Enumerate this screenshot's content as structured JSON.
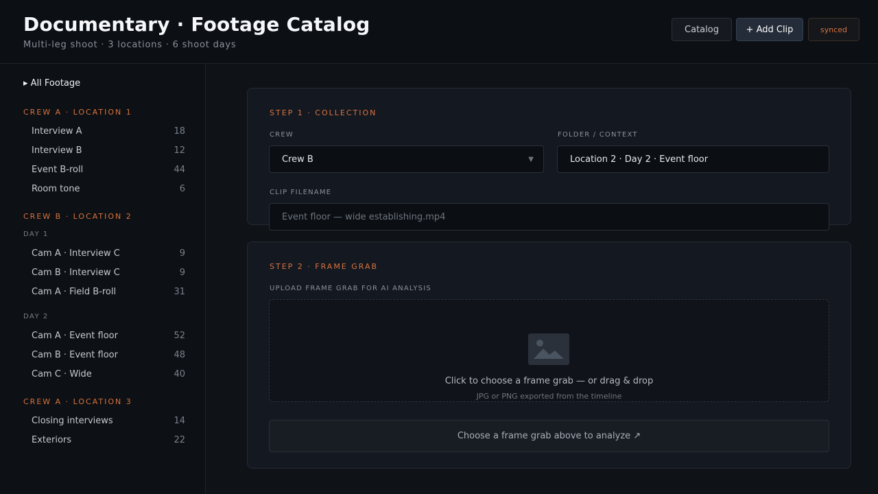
{
  "header": {
    "title": "Documentary · Footage Catalog",
    "subtitle": "Multi-leg shoot · 3 locations · 6 shoot days",
    "buttons": {
      "catalog": "Catalog",
      "add_clip": "+ Add Clip",
      "synced": "synced"
    }
  },
  "sidebar": {
    "all_label": "▸ All Footage",
    "groups": [
      {
        "title": "CREW A · LOCATION 1",
        "items": [
          {
            "label": "Interview A",
            "count": "18"
          },
          {
            "label": "Interview B",
            "count": "12"
          },
          {
            "label": "Event B-roll",
            "count": "44"
          },
          {
            "label": "Room tone",
            "count": "6"
          }
        ]
      },
      {
        "title": "CREW B · LOCATION 2",
        "days": [
          {
            "label": "DAY 1",
            "items": [
              {
                "label": "Cam A · Interview C",
                "count": "9"
              },
              {
                "label": "Cam B · Interview C",
                "count": "9"
              },
              {
                "label": "Cam A · Field B-roll",
                "count": "31"
              }
            ]
          },
          {
            "label": "DAY 2",
            "items": [
              {
                "label": "Cam A · Event floor",
                "count": "52"
              },
              {
                "label": "Cam B · Event floor",
                "count": "48"
              },
              {
                "label": "Cam C · Wide",
                "count": "40"
              }
            ]
          }
        ]
      },
      {
        "title": "CREW A · LOCATION 3",
        "items": [
          {
            "label": "Closing interviews",
            "count": "14"
          },
          {
            "label": "Exteriors",
            "count": "22"
          }
        ]
      }
    ]
  },
  "step1": {
    "heading": "STEP 1 · COLLECTION",
    "crew_label": "CREW",
    "crew_value": "Crew B",
    "folder_label": "FOLDER / CONTEXT",
    "folder_value": "Location 2 · Day 2 · Event floor",
    "filename_label": "CLIP FILENAME",
    "filename_placeholder": "Event floor — wide establishing.mp4"
  },
  "step2": {
    "heading": "STEP 2 · FRAME GRAB",
    "upload_label": "UPLOAD FRAME GRAB FOR AI ANALYSIS",
    "dropzone_title": "Click to choose a frame grab — or drag & drop",
    "dropzone_hint": "JPG or PNG exported from the timeline",
    "analyze_label": "Choose a frame grab above to analyze ↗"
  },
  "icons": {
    "dropzone": "image-icon",
    "crew_select": "chevron-down-icon"
  },
  "colors": {
    "accent": "#d9743f",
    "background": "#0f1217",
    "card": "#141820"
  }
}
